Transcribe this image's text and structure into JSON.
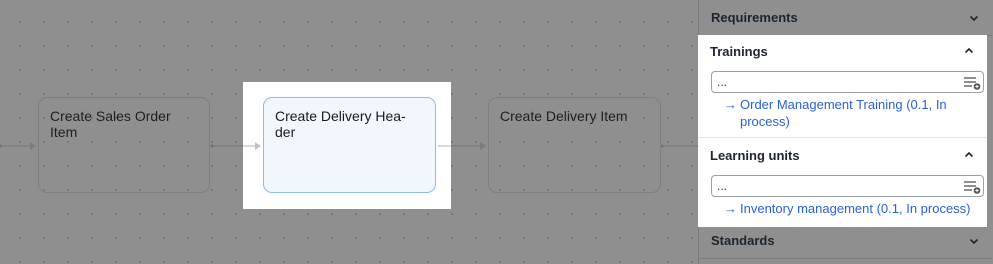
{
  "canvas": {
    "nodes": [
      {
        "label": "Create Sales Order Item"
      },
      {
        "label": "Create Delivery Hea-der"
      },
      {
        "label": "Create Delivery Item"
      }
    ]
  },
  "panel": {
    "requirements": {
      "title": "Requirements",
      "expanded": false
    },
    "trainings": {
      "title": "Trainings",
      "expanded": true,
      "search_value": "...",
      "items": [
        {
          "label": "Order Management Training (0.1, In process)"
        }
      ]
    },
    "learning_units": {
      "title": "Learning units",
      "expanded": true,
      "search_value": "...",
      "items": [
        {
          "label": "Inventory management (0.1, In process)"
        }
      ]
    },
    "standards": {
      "title": "Standards",
      "expanded": false
    }
  },
  "colors": {
    "overlay": "#8f8f8f",
    "link": "#2b5fd9",
    "selected_border": "#8bbde6",
    "selected_fill": "#f1f7fd"
  },
  "icons": [
    "chevron-down-icon",
    "chevron-up-icon",
    "filter-list-icon",
    "arrow-right-icon"
  ]
}
